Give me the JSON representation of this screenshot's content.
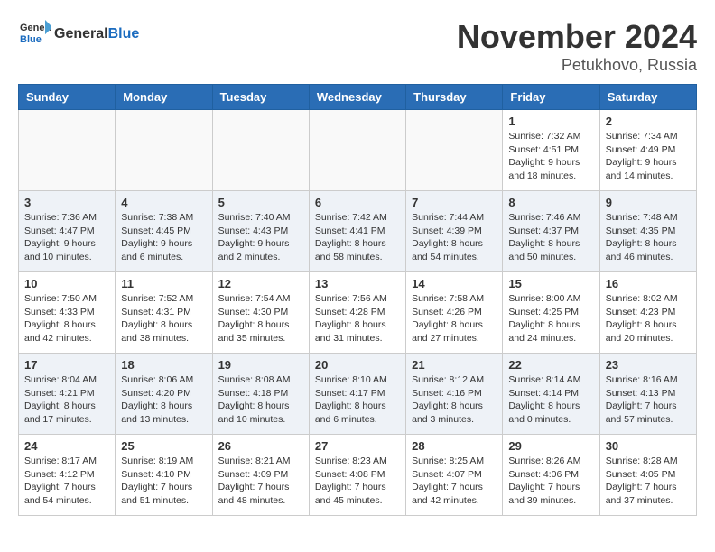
{
  "header": {
    "logo_general": "General",
    "logo_blue": "Blue",
    "month_title": "November 2024",
    "location": "Petukhovo, Russia"
  },
  "weekdays": [
    "Sunday",
    "Monday",
    "Tuesday",
    "Wednesday",
    "Thursday",
    "Friday",
    "Saturday"
  ],
  "weeks": [
    {
      "shaded": false,
      "days": [
        {
          "date": "",
          "info": ""
        },
        {
          "date": "",
          "info": ""
        },
        {
          "date": "",
          "info": ""
        },
        {
          "date": "",
          "info": ""
        },
        {
          "date": "",
          "info": ""
        },
        {
          "date": "1",
          "info": "Sunrise: 7:32 AM\nSunset: 4:51 PM\nDaylight: 9 hours and 18 minutes."
        },
        {
          "date": "2",
          "info": "Sunrise: 7:34 AM\nSunset: 4:49 PM\nDaylight: 9 hours and 14 minutes."
        }
      ]
    },
    {
      "shaded": true,
      "days": [
        {
          "date": "3",
          "info": "Sunrise: 7:36 AM\nSunset: 4:47 PM\nDaylight: 9 hours and 10 minutes."
        },
        {
          "date": "4",
          "info": "Sunrise: 7:38 AM\nSunset: 4:45 PM\nDaylight: 9 hours and 6 minutes."
        },
        {
          "date": "5",
          "info": "Sunrise: 7:40 AM\nSunset: 4:43 PM\nDaylight: 9 hours and 2 minutes."
        },
        {
          "date": "6",
          "info": "Sunrise: 7:42 AM\nSunset: 4:41 PM\nDaylight: 8 hours and 58 minutes."
        },
        {
          "date": "7",
          "info": "Sunrise: 7:44 AM\nSunset: 4:39 PM\nDaylight: 8 hours and 54 minutes."
        },
        {
          "date": "8",
          "info": "Sunrise: 7:46 AM\nSunset: 4:37 PM\nDaylight: 8 hours and 50 minutes."
        },
        {
          "date": "9",
          "info": "Sunrise: 7:48 AM\nSunset: 4:35 PM\nDaylight: 8 hours and 46 minutes."
        }
      ]
    },
    {
      "shaded": false,
      "days": [
        {
          "date": "10",
          "info": "Sunrise: 7:50 AM\nSunset: 4:33 PM\nDaylight: 8 hours and 42 minutes."
        },
        {
          "date": "11",
          "info": "Sunrise: 7:52 AM\nSunset: 4:31 PM\nDaylight: 8 hours and 38 minutes."
        },
        {
          "date": "12",
          "info": "Sunrise: 7:54 AM\nSunset: 4:30 PM\nDaylight: 8 hours and 35 minutes."
        },
        {
          "date": "13",
          "info": "Sunrise: 7:56 AM\nSunset: 4:28 PM\nDaylight: 8 hours and 31 minutes."
        },
        {
          "date": "14",
          "info": "Sunrise: 7:58 AM\nSunset: 4:26 PM\nDaylight: 8 hours and 27 minutes."
        },
        {
          "date": "15",
          "info": "Sunrise: 8:00 AM\nSunset: 4:25 PM\nDaylight: 8 hours and 24 minutes."
        },
        {
          "date": "16",
          "info": "Sunrise: 8:02 AM\nSunset: 4:23 PM\nDaylight: 8 hours and 20 minutes."
        }
      ]
    },
    {
      "shaded": true,
      "days": [
        {
          "date": "17",
          "info": "Sunrise: 8:04 AM\nSunset: 4:21 PM\nDaylight: 8 hours and 17 minutes."
        },
        {
          "date": "18",
          "info": "Sunrise: 8:06 AM\nSunset: 4:20 PM\nDaylight: 8 hours and 13 minutes."
        },
        {
          "date": "19",
          "info": "Sunrise: 8:08 AM\nSunset: 4:18 PM\nDaylight: 8 hours and 10 minutes."
        },
        {
          "date": "20",
          "info": "Sunrise: 8:10 AM\nSunset: 4:17 PM\nDaylight: 8 hours and 6 minutes."
        },
        {
          "date": "21",
          "info": "Sunrise: 8:12 AM\nSunset: 4:16 PM\nDaylight: 8 hours and 3 minutes."
        },
        {
          "date": "22",
          "info": "Sunrise: 8:14 AM\nSunset: 4:14 PM\nDaylight: 8 hours and 0 minutes."
        },
        {
          "date": "23",
          "info": "Sunrise: 8:16 AM\nSunset: 4:13 PM\nDaylight: 7 hours and 57 minutes."
        }
      ]
    },
    {
      "shaded": false,
      "days": [
        {
          "date": "24",
          "info": "Sunrise: 8:17 AM\nSunset: 4:12 PM\nDaylight: 7 hours and 54 minutes."
        },
        {
          "date": "25",
          "info": "Sunrise: 8:19 AM\nSunset: 4:10 PM\nDaylight: 7 hours and 51 minutes."
        },
        {
          "date": "26",
          "info": "Sunrise: 8:21 AM\nSunset: 4:09 PM\nDaylight: 7 hours and 48 minutes."
        },
        {
          "date": "27",
          "info": "Sunrise: 8:23 AM\nSunset: 4:08 PM\nDaylight: 7 hours and 45 minutes."
        },
        {
          "date": "28",
          "info": "Sunrise: 8:25 AM\nSunset: 4:07 PM\nDaylight: 7 hours and 42 minutes."
        },
        {
          "date": "29",
          "info": "Sunrise: 8:26 AM\nSunset: 4:06 PM\nDaylight: 7 hours and 39 minutes."
        },
        {
          "date": "30",
          "info": "Sunrise: 8:28 AM\nSunset: 4:05 PM\nDaylight: 7 hours and 37 minutes."
        }
      ]
    }
  ]
}
